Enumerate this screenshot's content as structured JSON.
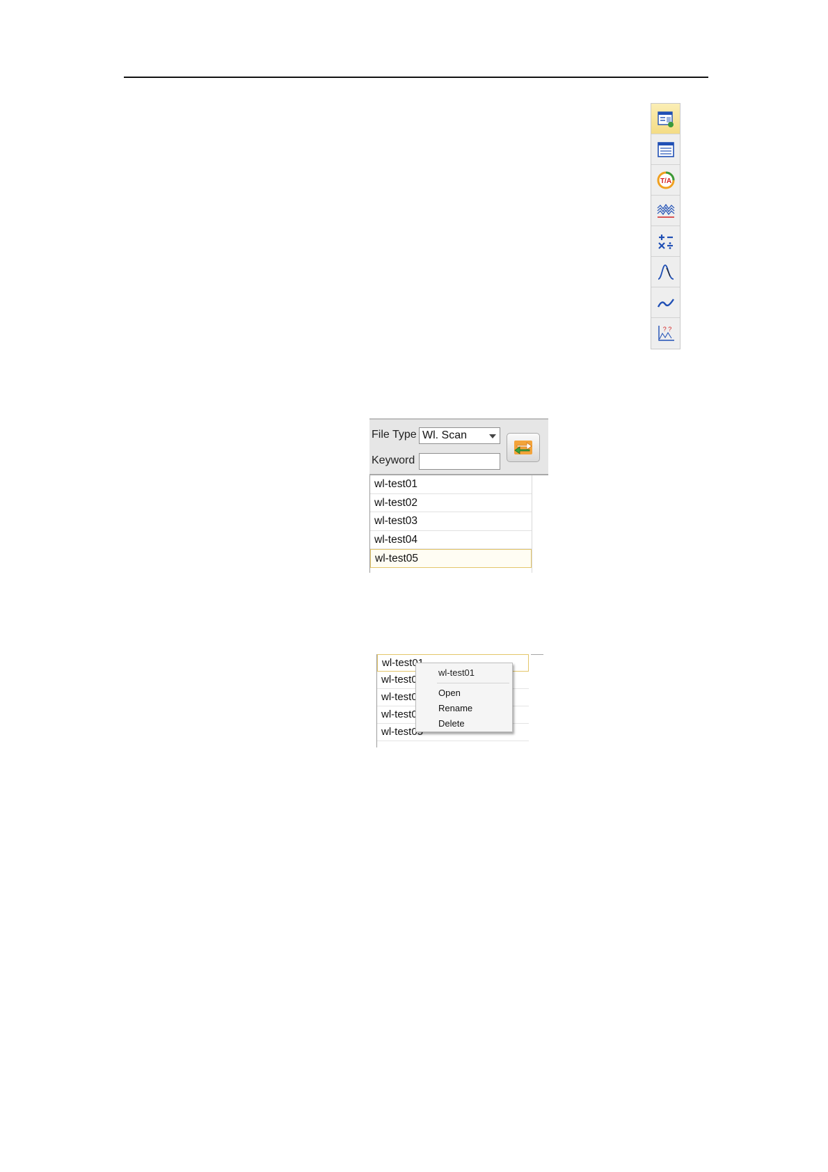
{
  "toolbar": {
    "icons": [
      "file-list-icon",
      "window-list-icon",
      "ta-icon",
      "multi-spectrum-icon",
      "arithmetic-icon",
      "peak-icon",
      "smooth-curve-icon",
      "unknown-analysis-icon"
    ],
    "ta_text": "T/A",
    "unknown_text": "? ?",
    "colors": {
      "active_bg": "#f4dc85",
      "icon_blue": "#1f4fb5",
      "icon_red": "#d42020",
      "icon_orange": "#f0a020"
    }
  },
  "file_panel": {
    "file_type_label": "File Type",
    "file_type_value": "Wl. Scan",
    "keyword_label": "Keyword",
    "keyword_value": "",
    "refresh_icon": "refresh-swap-icon",
    "files": [
      "wl-test01",
      "wl-test02",
      "wl-test03",
      "wl-test04",
      "wl-test05"
    ],
    "selected_index": 4
  },
  "context_view": {
    "files": [
      "wl-test01",
      "wl-test02",
      "wl-test03",
      "wl-test04",
      "wl-test05"
    ],
    "menu": {
      "title": "wl-test01",
      "items": [
        "Open",
        "Rename",
        "Delete"
      ]
    }
  }
}
